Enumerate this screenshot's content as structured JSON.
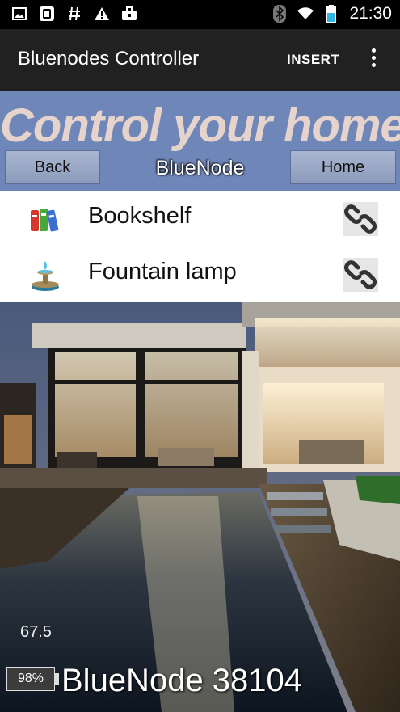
{
  "status_bar": {
    "time": "21:30",
    "left_icons": [
      "image-icon",
      "phone-icon",
      "hash-icon",
      "warning-icon",
      "briefcase-icon"
    ],
    "right_icons": [
      "bluetooth-icon",
      "wifi-icon",
      "battery-icon"
    ]
  },
  "app_bar": {
    "title": "Bluenodes Controller",
    "insert_label": "INSERT"
  },
  "hero": {
    "title": "Control your home",
    "subtitle": "BlueNode",
    "back_label": "Back",
    "home_label": "Home",
    "background_color": "#6f86b8",
    "title_color": "#e6d3cc"
  },
  "devices": [
    {
      "label": "Bookshelf",
      "icon": "books-icon"
    },
    {
      "label": "Fountain lamp",
      "icon": "fountain-icon"
    }
  ],
  "footer": {
    "temperature": "67.5",
    "battery": "98%",
    "node_name": "BlueNode 38104"
  }
}
